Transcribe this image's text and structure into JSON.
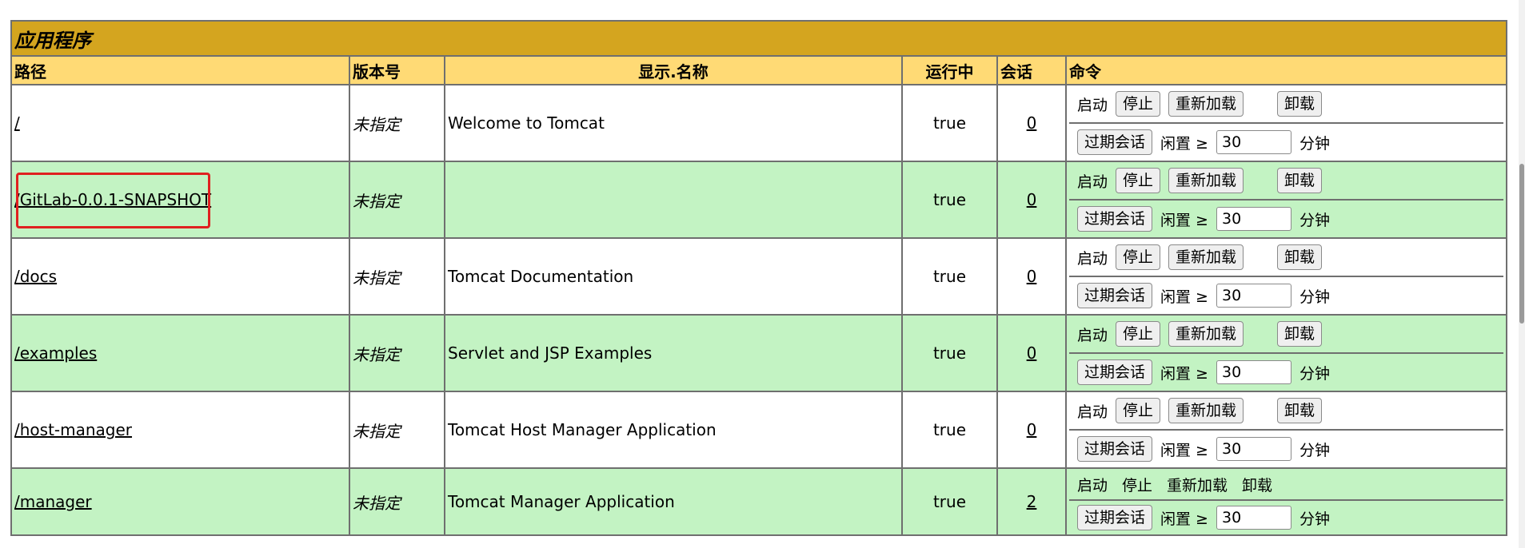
{
  "table": {
    "title": "应用程序",
    "headers": {
      "path": "路径",
      "version": "版本号",
      "display_name": "显示.名称",
      "running": "运行中",
      "sessions": "会话",
      "commands": "命令"
    },
    "rows": [
      {
        "path": "/",
        "version": "未指定",
        "display_name": "Welcome to Tomcat",
        "running": "true",
        "sessions": "0"
      },
      {
        "path": "/GitLab-0.0.1-SNAPSHOT",
        "version": "未指定",
        "display_name": "",
        "running": "true",
        "sessions": "0"
      },
      {
        "path": "/docs",
        "version": "未指定",
        "display_name": "Tomcat Documentation",
        "running": "true",
        "sessions": "0"
      },
      {
        "path": "/examples",
        "version": "未指定",
        "display_name": "Servlet and JSP Examples",
        "running": "true",
        "sessions": "0"
      },
      {
        "path": "/host-manager",
        "version": "未指定",
        "display_name": "Tomcat Host Manager Application",
        "running": "true",
        "sessions": "0"
      },
      {
        "path": "/manager",
        "version": "未指定",
        "display_name": "Tomcat Manager Application",
        "running": "true",
        "sessions": "2"
      }
    ]
  },
  "commands": {
    "start": "启动",
    "stop": "停止",
    "reload": "重新加载",
    "undeploy": "卸载",
    "expire_sessions": "过期会话",
    "idle": "闲置 ≥",
    "idle_value": "30",
    "minutes": "分钟"
  },
  "colors": {
    "title_bg": "#d4a51f",
    "header_bg": "#ffda75",
    "row_green": "#c3f3c3",
    "row_white": "#ffffff",
    "highlight_border": "#e02020"
  }
}
